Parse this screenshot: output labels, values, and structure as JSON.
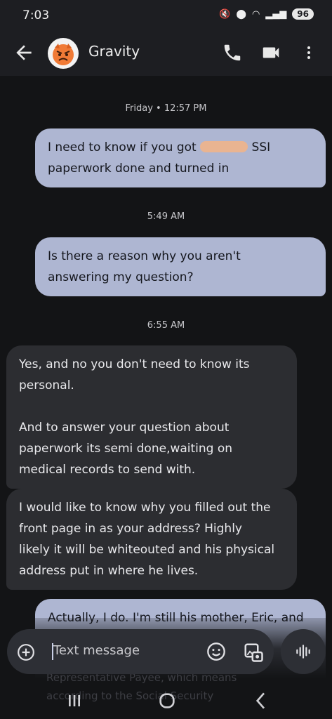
{
  "status_bar": {
    "time": "7:03",
    "battery": "96"
  },
  "conversation": {
    "contact_name": "Gravity"
  },
  "messages": [
    {
      "type": "timestamp",
      "text": "Friday • 12:57 PM"
    },
    {
      "type": "outgoing",
      "lines": [
        "I need to know if you got",
        "SSI",
        "paperwork done and turned in"
      ]
    },
    {
      "type": "timestamp",
      "text": "5:49 AM"
    },
    {
      "type": "outgoing",
      "lines": [
        "Is there a reason why you aren't",
        "answering my question?"
      ]
    },
    {
      "type": "timestamp",
      "text": "6:55 AM"
    },
    {
      "type": "incoming",
      "lines": [
        "Yes, and no you don't need to know its",
        "personal.",
        "",
        "And to answer your question about",
        "paperwork its semi done,waiting on",
        "medical records to send with."
      ]
    },
    {
      "type": "incoming",
      "lines": [
        "I would like to know why you filled out the",
        "front page in as your address? Highly",
        "likely it will be whiteouted and his physical",
        "address put in where he lives."
      ]
    },
    {
      "type": "outgoing",
      "lines": [
        "Actually, I do. I'm still his mother, Eric, and"
      ]
    }
  ],
  "hidden_text_lines": [
    "Representative Payee, which means",
    "according to the Social Security"
  ],
  "composer": {
    "placeholder": "Text message"
  },
  "colors": {
    "outgoing_bubble": "#aeb6d2",
    "incoming_bubble": "#2c2d31",
    "background": "#131416"
  }
}
